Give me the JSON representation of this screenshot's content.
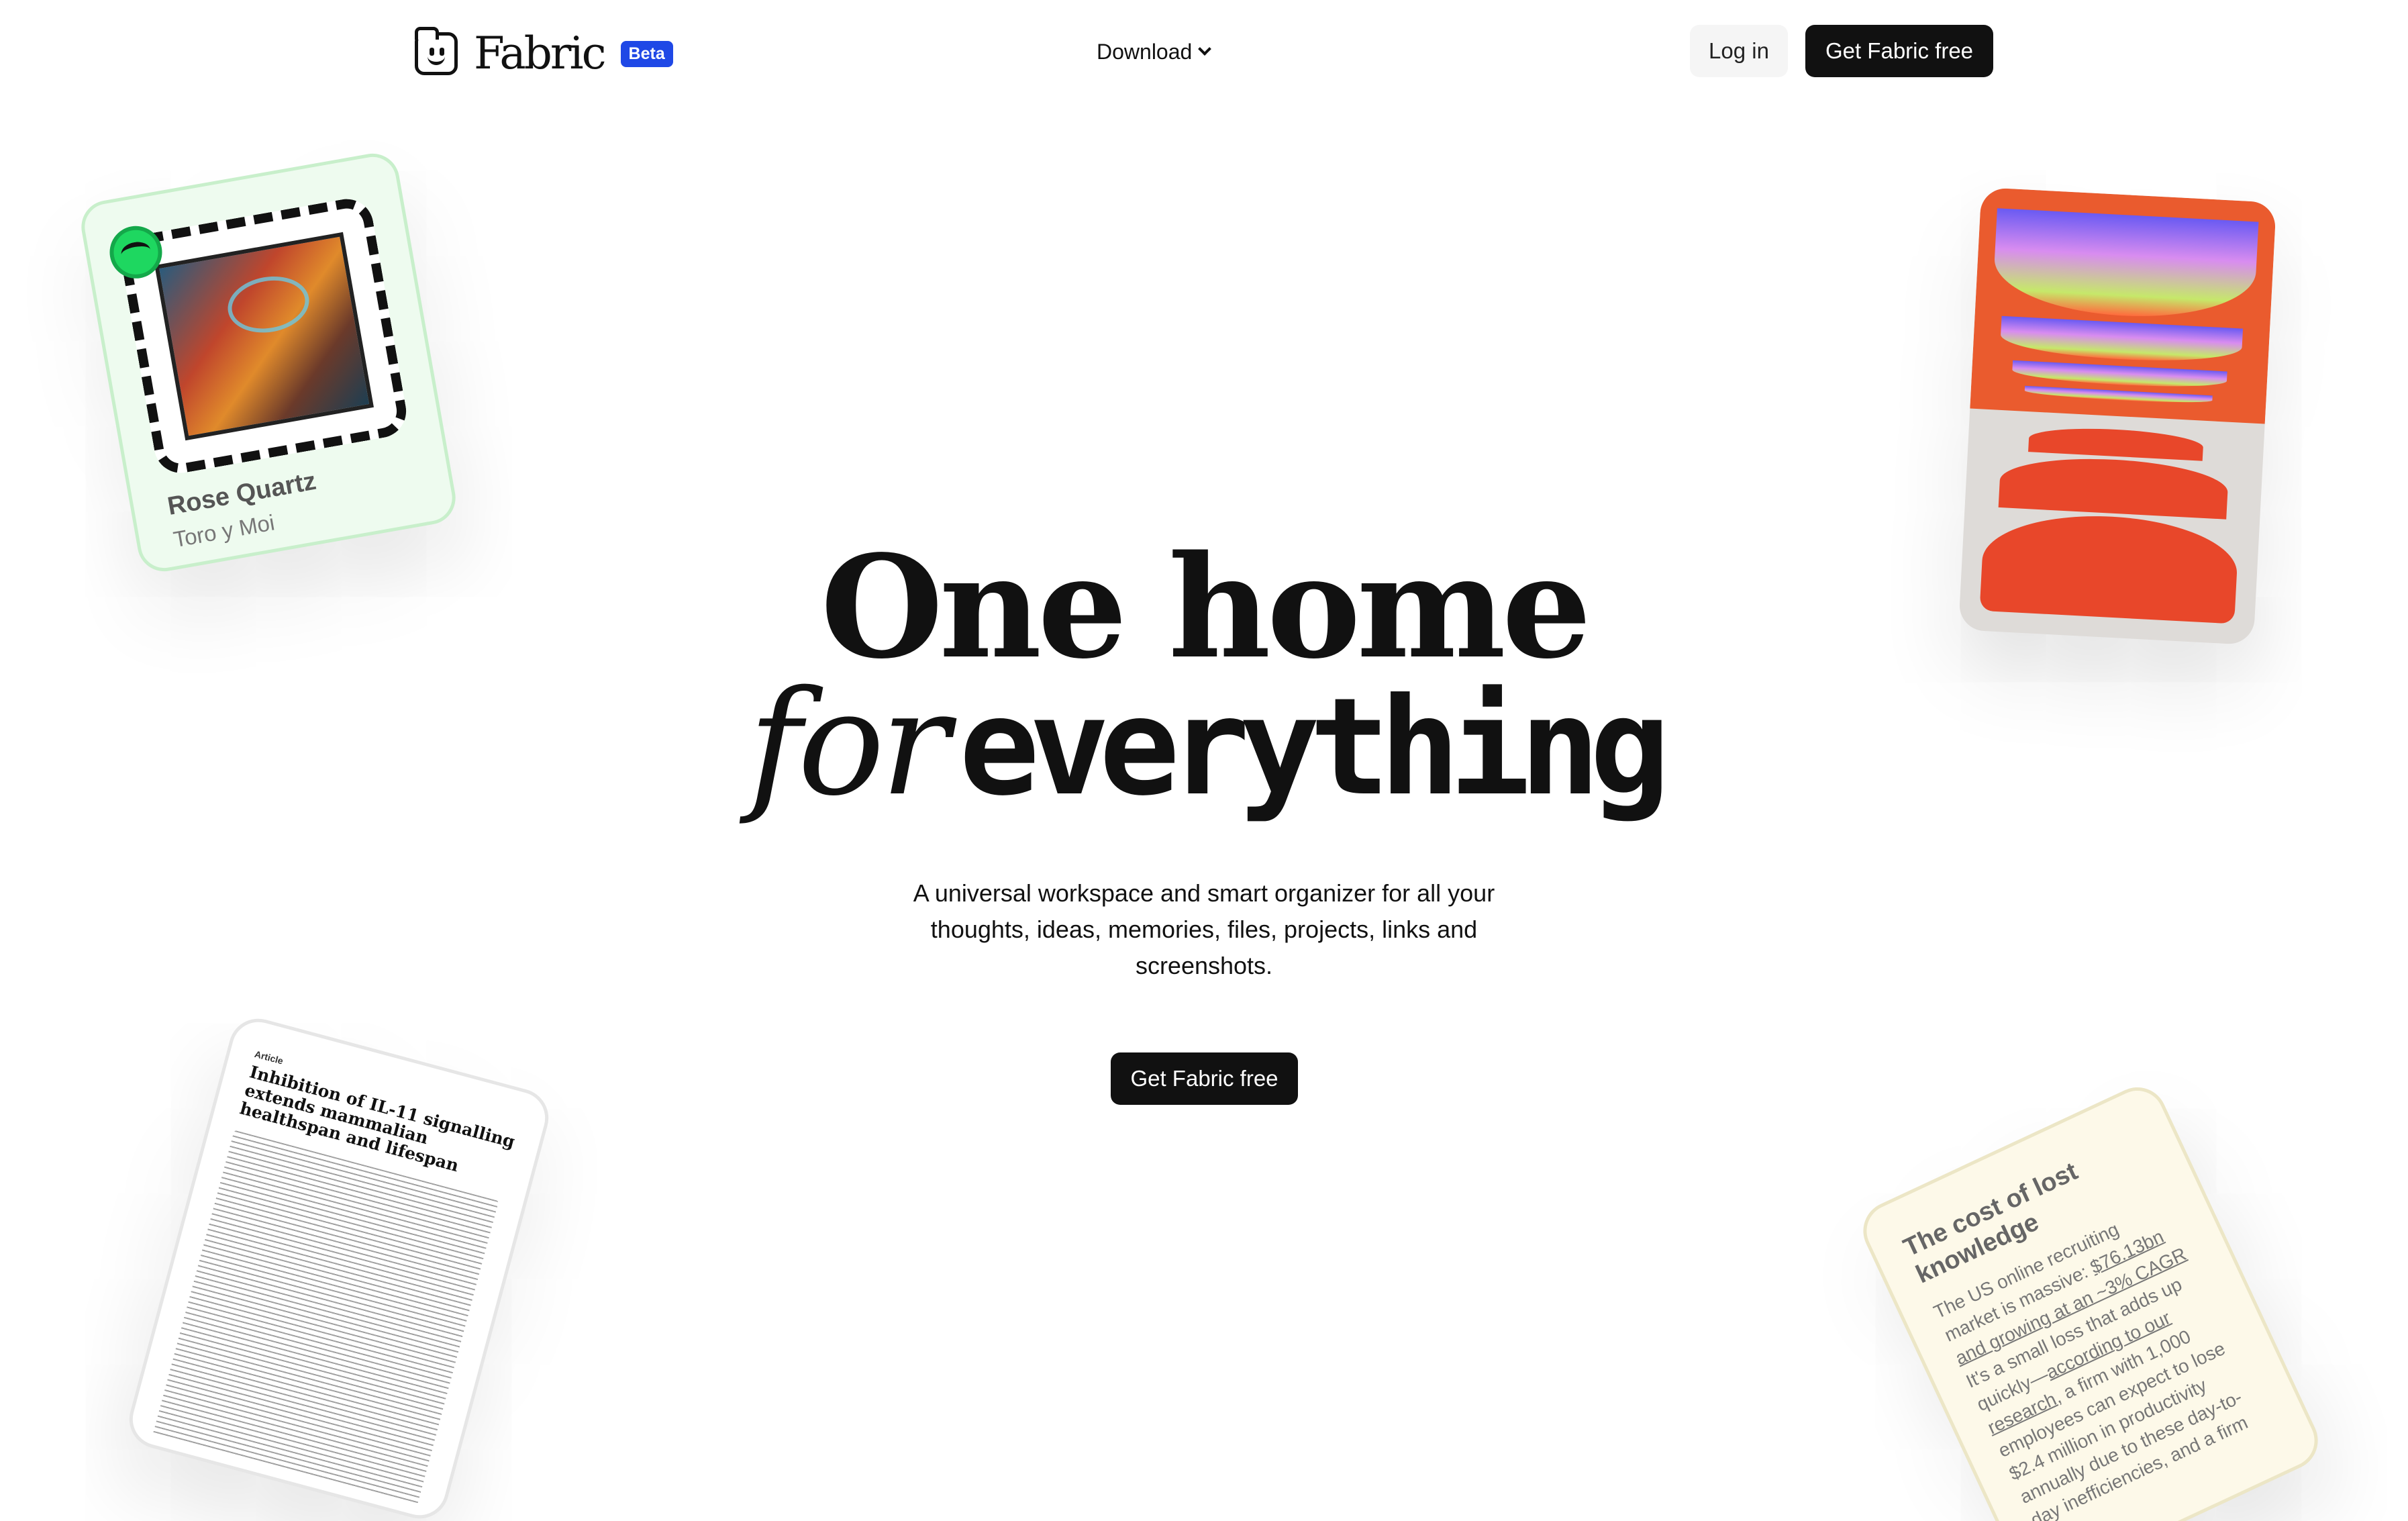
{
  "nav": {
    "logo_text": "Fabric",
    "beta_badge": "Beta",
    "download_label": "Download",
    "login_label": "Log in",
    "cta_label": "Get Fabric free"
  },
  "hero": {
    "line1": "One home",
    "line2_italic": "for",
    "line2_pixel": "everything",
    "subtitle": "A universal workspace and smart organizer for all your thoughts, ideas, memories, files, projects, links and screenshots.",
    "cta_label": "Get Fabric free"
  },
  "cards": {
    "music": {
      "title": "Rose Quartz",
      "artist": "Toro y Moi",
      "icon": "spotify-icon"
    },
    "paper": {
      "label": "Article",
      "title": "Inhibition of IL-11 signalling extends mammalian healthspan and lifespan"
    },
    "note": {
      "title": "The cost of lost knowledge",
      "body_1": "The US online recruiting market is massive: ",
      "link_1": "$76.13bn and growing at an ~3% CAGR",
      "body_2": " It's a small loss that adds up quickly—",
      "link_2": "according to our research",
      "body_3": ", a firm with 1,000 employees can expect to lose $2.4 million in productivity annually due to these day-to-day inefficiencies, and a firm"
    }
  },
  "colors": {
    "brand_blue": "#1f48e6",
    "button_dark": "#111111",
    "music_card_bg": "#eefbef",
    "note_card_bg": "#fdf9e9",
    "art_orange": "#ea5b2e"
  }
}
